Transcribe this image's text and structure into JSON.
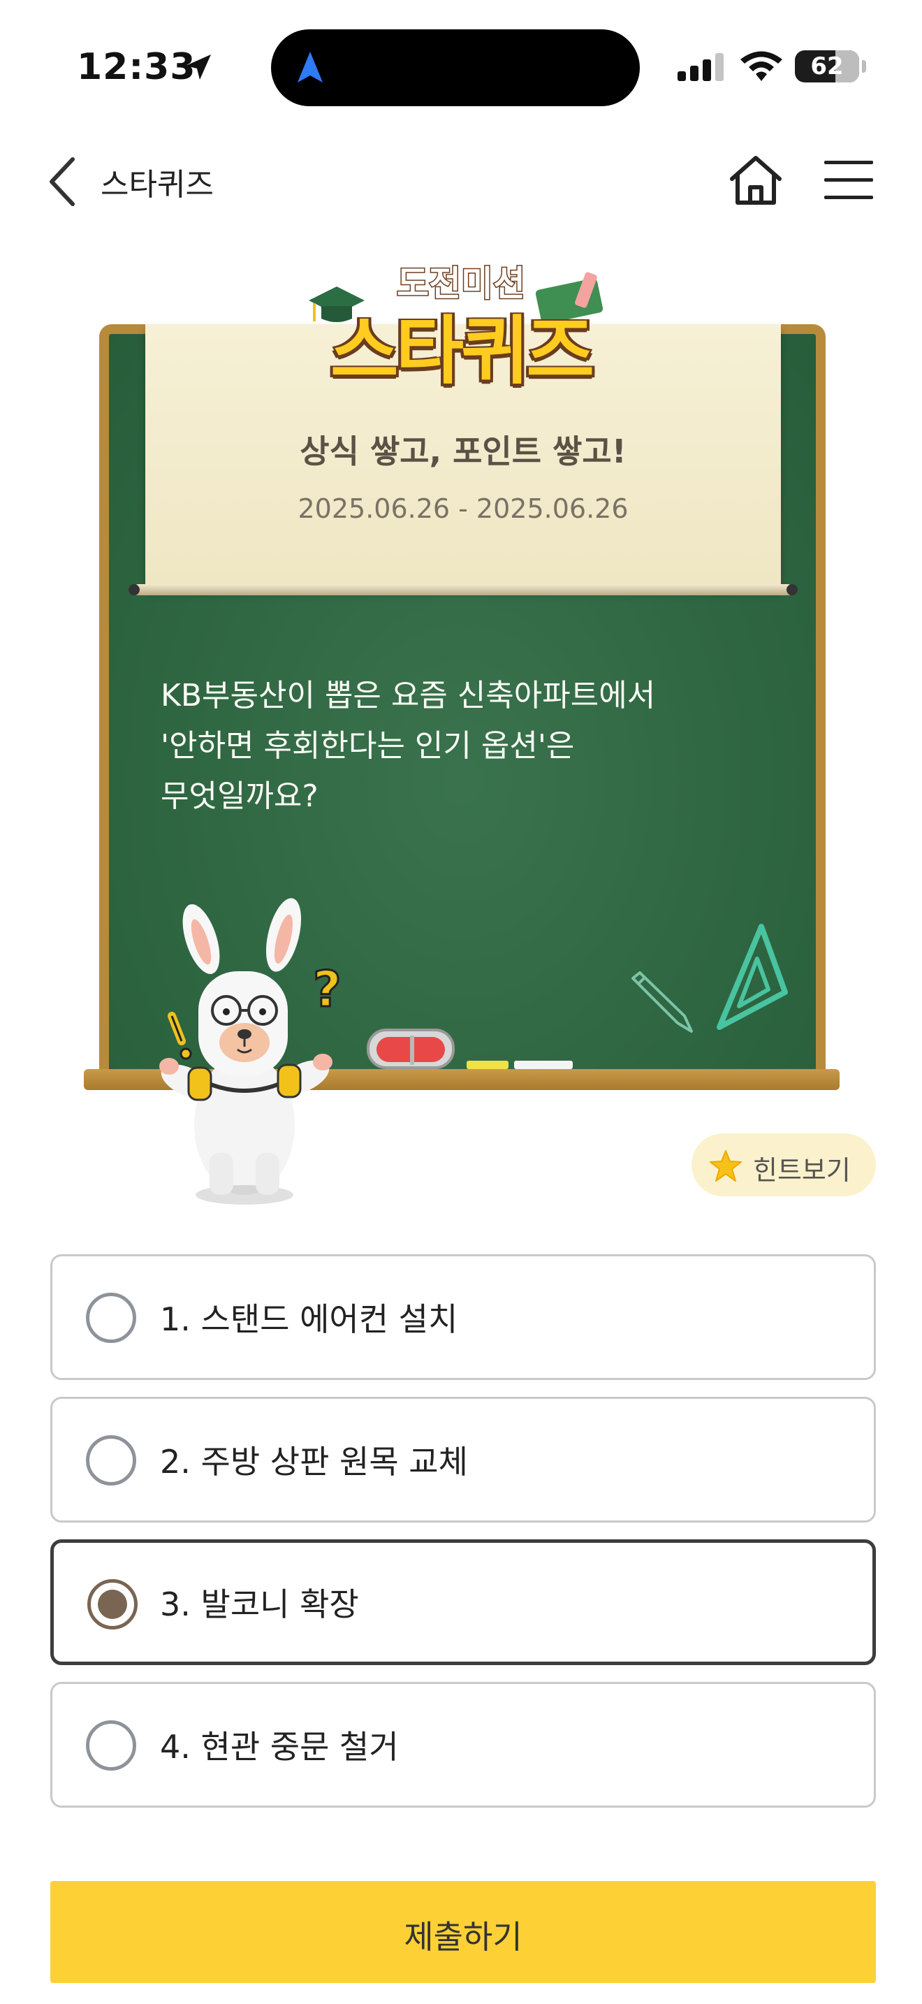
{
  "status_bar": {
    "time": "12:33",
    "battery": "62"
  },
  "header": {
    "title": "스타퀴즈"
  },
  "banner": {
    "logo_top": "도전미션",
    "logo_main": "스타퀴즈",
    "subtitle": "상식 쌓고, 포인트 쌓고!",
    "period": "2025.06.26 - 2025.06.26"
  },
  "question": {
    "text": "KB부동산이 뽑은 요즘 신축아파트에서\n'안하면 후회한다는 인기 옵션'은\n무엇일까요?"
  },
  "hint": {
    "label": "힌트보기"
  },
  "options": [
    {
      "label": "1. 스탠드 에어컨 설치",
      "selected": false
    },
    {
      "label": "2. 주방 상판 원목 교체",
      "selected": false
    },
    {
      "label": "3. 발코니 확장",
      "selected": true
    },
    {
      "label": "4. 현관 중문 철거",
      "selected": false
    }
  ],
  "submit": {
    "label": "제출하기"
  },
  "colors": {
    "board": "#2d6a42",
    "board_frame": "#b88a3c",
    "submit": "#fdd135",
    "selected_radio": "#7a6552"
  }
}
